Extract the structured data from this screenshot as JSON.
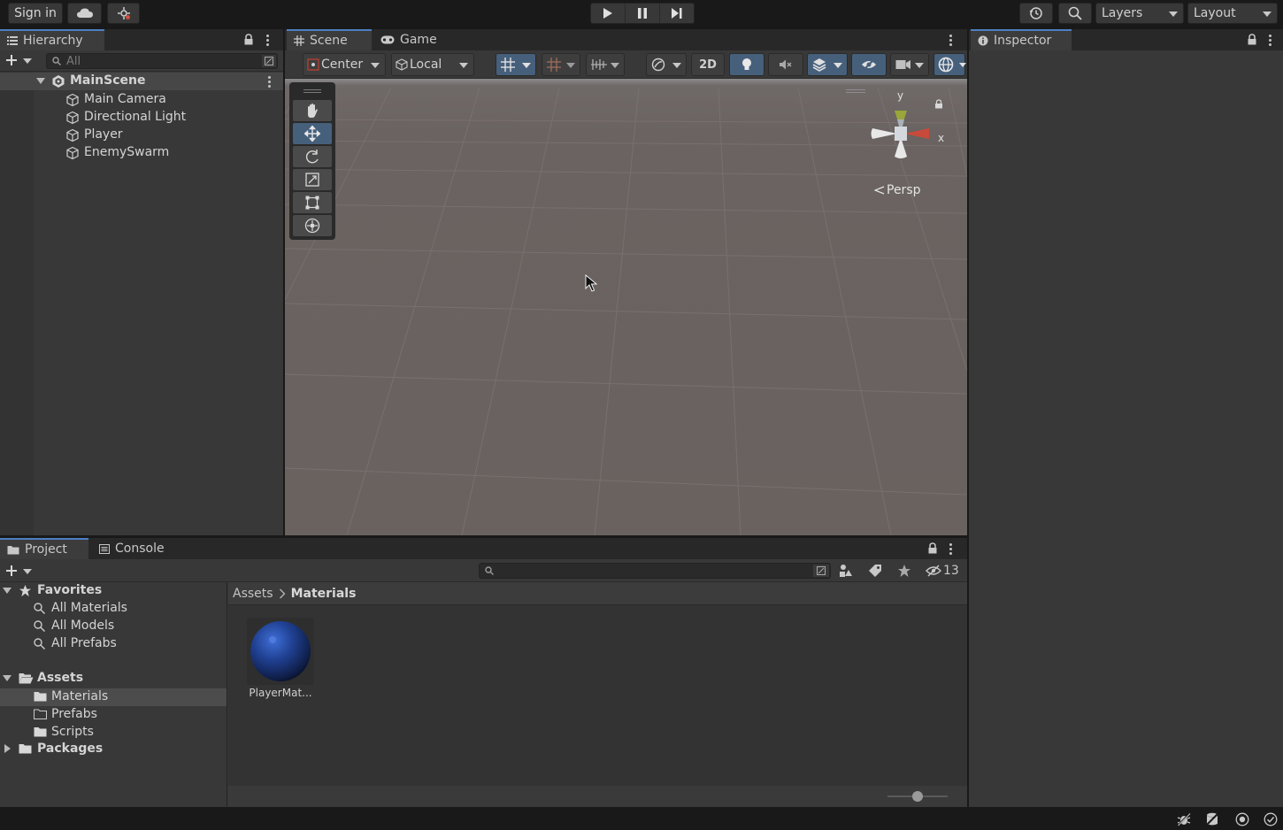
{
  "topbar": {
    "sign_in": "Sign in",
    "layers_label": "Layers",
    "layout_label": "Layout"
  },
  "hierarchy": {
    "tab": "Hierarchy",
    "search_placeholder": "All",
    "scene": "MainScene",
    "objects": [
      "Main Camera",
      "Directional Light",
      "Player",
      "EnemySwarm"
    ]
  },
  "scene_view": {
    "tab_scene": "Scene",
    "tab_game": "Game",
    "pivot_mode": "Center",
    "pivot_rotation": "Local",
    "two_d_label": "2D",
    "gizmo_y": "y",
    "gizmo_x": "x",
    "projection": "Persp"
  },
  "inspector": {
    "tab": "Inspector"
  },
  "project": {
    "tab_project": "Project",
    "tab_console": "Console",
    "hidden_count": "13",
    "favorites_label": "Favorites",
    "favorites": [
      "All Materials",
      "All Models",
      "All Prefabs"
    ],
    "assets_label": "Assets",
    "asset_folders": [
      "Materials",
      "Prefabs",
      "Scripts"
    ],
    "packages_label": "Packages",
    "breadcrumb_root": "Assets",
    "breadcrumb_current": "Materials",
    "asset_item_label": "PlayerMat...",
    "zoom_level": 0.5
  },
  "colors": {
    "accent": "#4d7fc4",
    "selected_tool": "#46607c",
    "material_sphere": "#1f3f8f"
  }
}
